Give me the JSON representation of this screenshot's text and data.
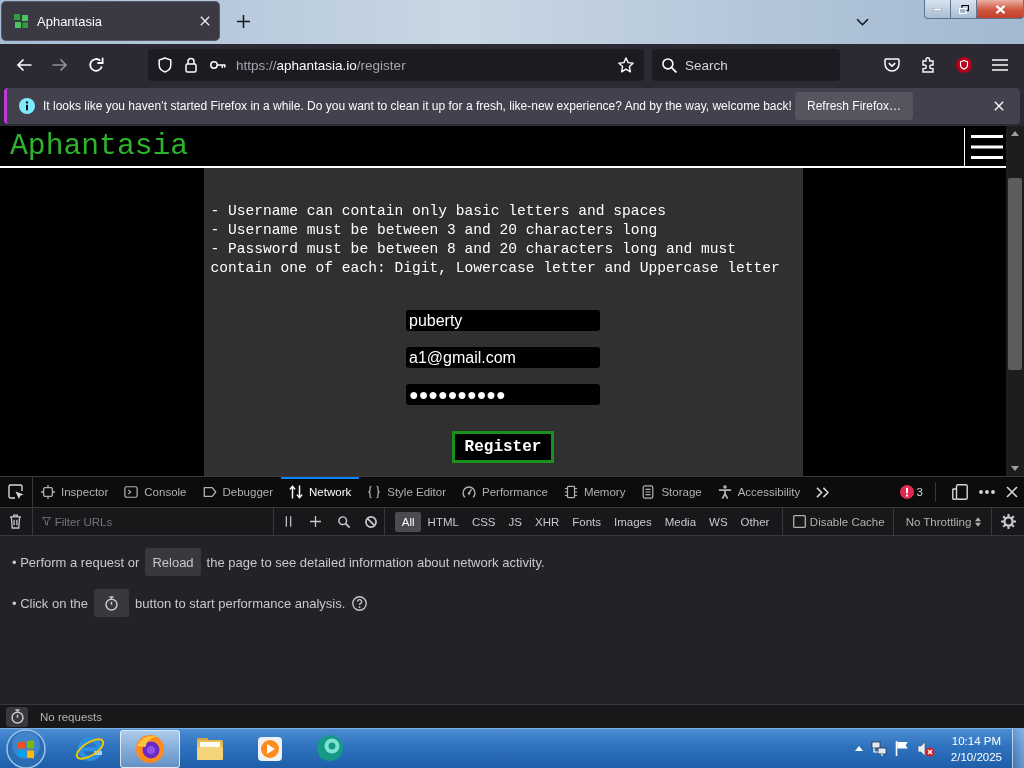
{
  "browser": {
    "tabs": [
      {
        "title": "Aphantasia",
        "selected": true
      }
    ],
    "forward": {
      "disabled": true
    },
    "url": {
      "scheme": "https://",
      "host": "aphantasia.io",
      "path": "/register"
    },
    "search_placeholder": "Search"
  },
  "notification": {
    "message": "It looks like you haven’t started Firefox in a while. Do you want to clean it up for a fresh, like-new experience? And by the way, welcome back!",
    "button": "Refresh Firefox…"
  },
  "page": {
    "logo": "Aphantasia",
    "rules": [
      "- Username can contain only basic letters and spaces",
      "- Username must be between 3 and 20 characters long",
      "- Password must be between 8 and 20 characters long and must contain one of each: Digit, Lowercase letter and Uppercase letter"
    ],
    "fields": [
      {
        "value": "puberty"
      },
      {
        "value": "a1@gmail.com"
      },
      {
        "value": "●●●●●●●●●●"
      }
    ],
    "submit": "Register"
  },
  "devtools": {
    "tabs": [
      {
        "label": "Inspector",
        "selected": false
      },
      {
        "label": "Console",
        "selected": false
      },
      {
        "label": "Debugger",
        "selected": false
      },
      {
        "label": "Network",
        "selected": true
      },
      {
        "label": "Style Editor",
        "selected": false
      },
      {
        "label": "Performance",
        "selected": false
      },
      {
        "label": "Memory",
        "selected": false
      },
      {
        "label": "Storage",
        "selected": false
      },
      {
        "label": "Accessibility",
        "selected": false
      }
    ],
    "error_count": "3",
    "filter_placeholder": "Filter URLs",
    "type_filters": [
      {
        "label": "All",
        "selected": true
      },
      {
        "label": "HTML",
        "selected": false
      },
      {
        "label": "CSS",
        "selected": false
      },
      {
        "label": "JS",
        "selected": false
      },
      {
        "label": "XHR",
        "selected": false
      },
      {
        "label": "Fonts",
        "selected": false
      },
      {
        "label": "Images",
        "selected": false
      },
      {
        "label": "Media",
        "selected": false
      },
      {
        "label": "WS",
        "selected": false
      },
      {
        "label": "Other",
        "selected": false
      }
    ],
    "disable_cache": {
      "label": "Disable Cache",
      "checked": false
    },
    "throttling": "No Throttling",
    "hints": [
      {
        "kind": "reload",
        "before": "• Perform a request or",
        "button": "Reload",
        "after": "the page to see detailed information about network activity."
      },
      {
        "kind": "performance",
        "before": "• Click on the",
        "after": "button to start performance analysis."
      }
    ],
    "status": "No requests"
  },
  "taskbar": {
    "apps": [
      {
        "selected": false
      },
      {
        "selected": true
      },
      {
        "selected": false
      },
      {
        "selected": false
      },
      {
        "selected": false
      }
    ],
    "time": "10:14 PM",
    "date": "2/10/2025"
  }
}
